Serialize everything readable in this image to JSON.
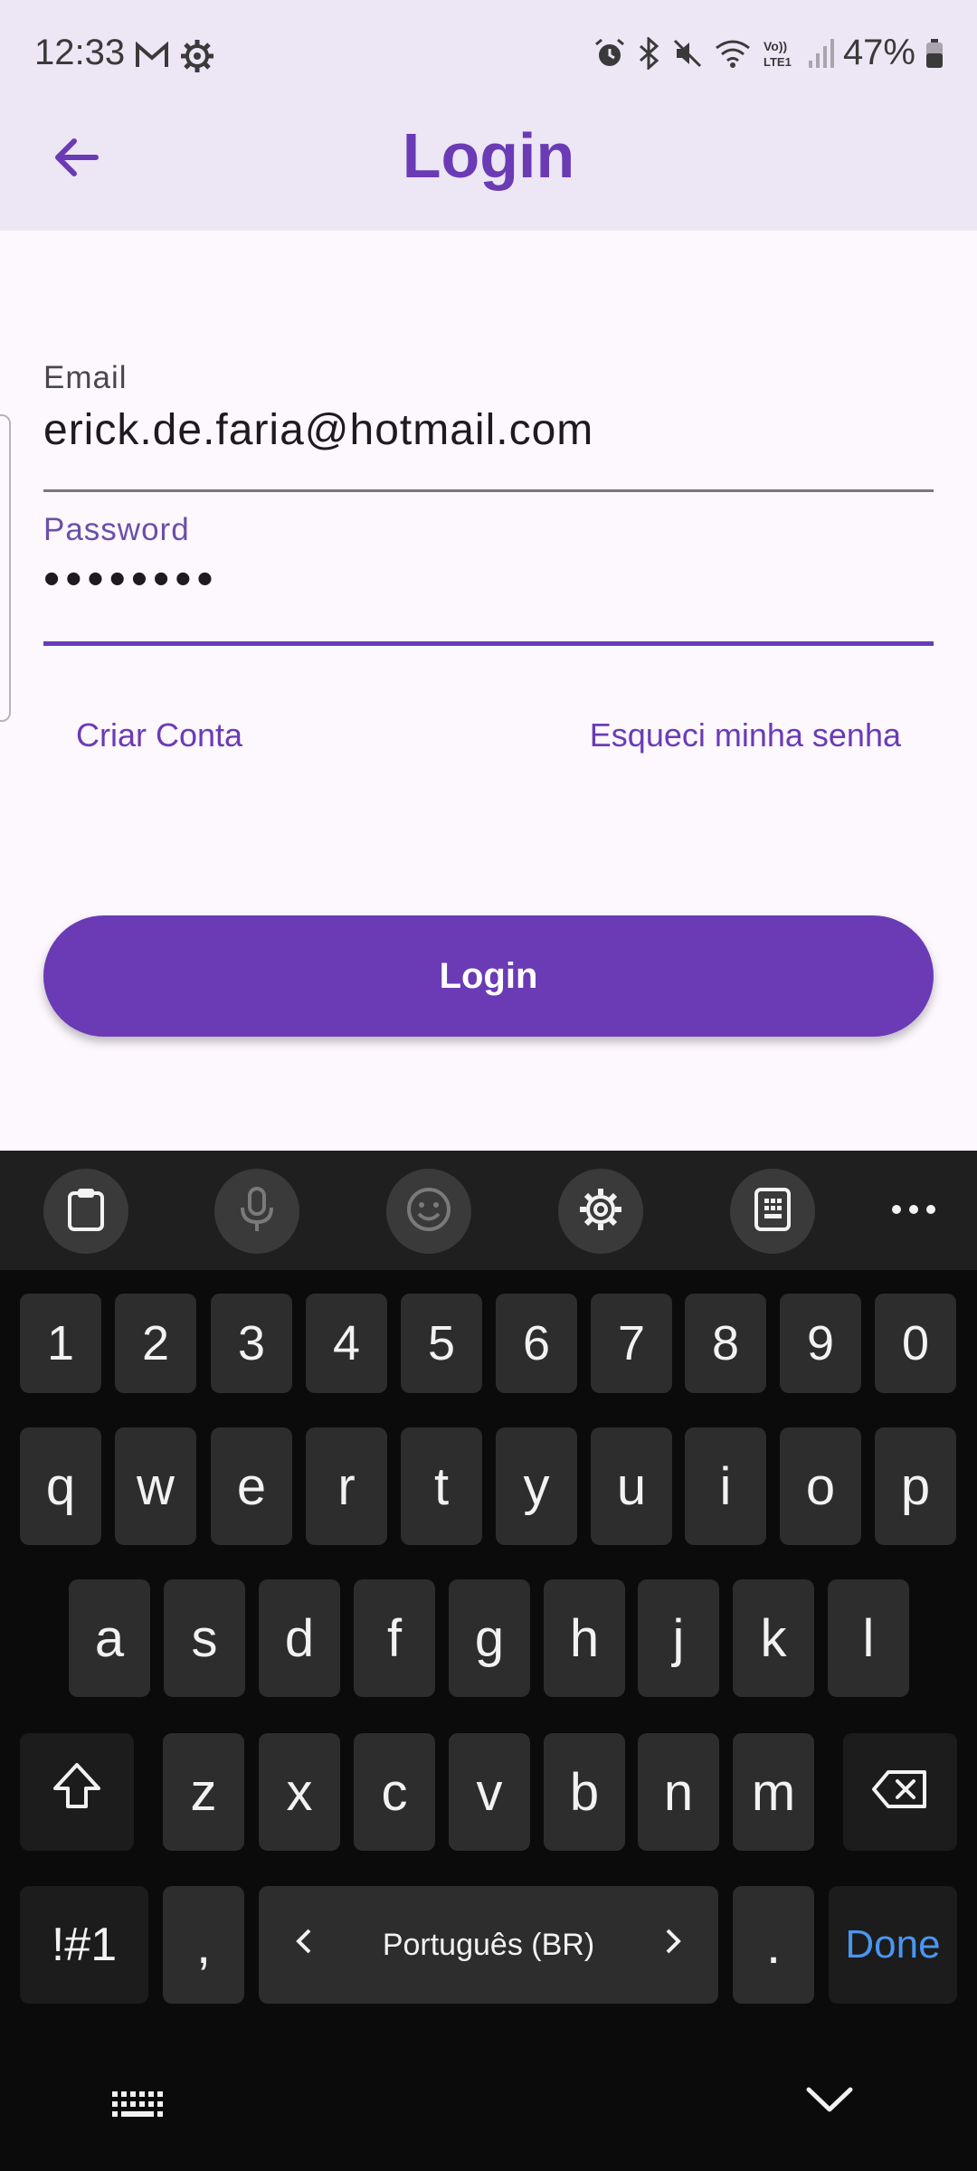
{
  "status_bar": {
    "time": "12:33",
    "battery_text": "47%",
    "left_icons": [
      "gmail-icon",
      "settings-gear-icon"
    ],
    "right_icons": [
      "alarm-icon",
      "bluetooth-icon",
      "mute-icon",
      "wifi-icon",
      "volte-icon",
      "signal-icon",
      "battery-icon"
    ]
  },
  "app_bar": {
    "title": "Login",
    "back_icon": "arrow-left-icon"
  },
  "form": {
    "email_label": "Email",
    "email_value": "erick.de.faria@hotmail.com",
    "password_label": "Password",
    "password_value": "••••••••",
    "create_account_link": "Criar Conta",
    "forgot_password_link": "Esqueci minha senha",
    "login_button": "Login"
  },
  "keyboard": {
    "toolbar_icons": [
      "clipboard-icon",
      "microphone-icon",
      "emoji-icon",
      "settings-icon",
      "keypad-icon",
      "more-icon"
    ],
    "number_row": [
      "1",
      "2",
      "3",
      "4",
      "5",
      "6",
      "7",
      "8",
      "9",
      "0"
    ],
    "row1": [
      "q",
      "w",
      "e",
      "r",
      "t",
      "y",
      "u",
      "i",
      "o",
      "p"
    ],
    "row2": [
      "a",
      "s",
      "d",
      "f",
      "g",
      "h",
      "j",
      "k",
      "l"
    ],
    "row3": [
      "z",
      "x",
      "c",
      "v",
      "b",
      "n",
      "m"
    ],
    "symbols_key": "!#1",
    "comma_key": ",",
    "space_label": "Português (BR)",
    "period_key": ".",
    "done_key": "Done",
    "done_color": "#4a96ef"
  },
  "colors": {
    "accent": "#6a3bb5",
    "app_bar_bg": "#ede6f4",
    "page_bg": "#fdf7fe",
    "keyboard_bg": "#0b0b0b"
  }
}
